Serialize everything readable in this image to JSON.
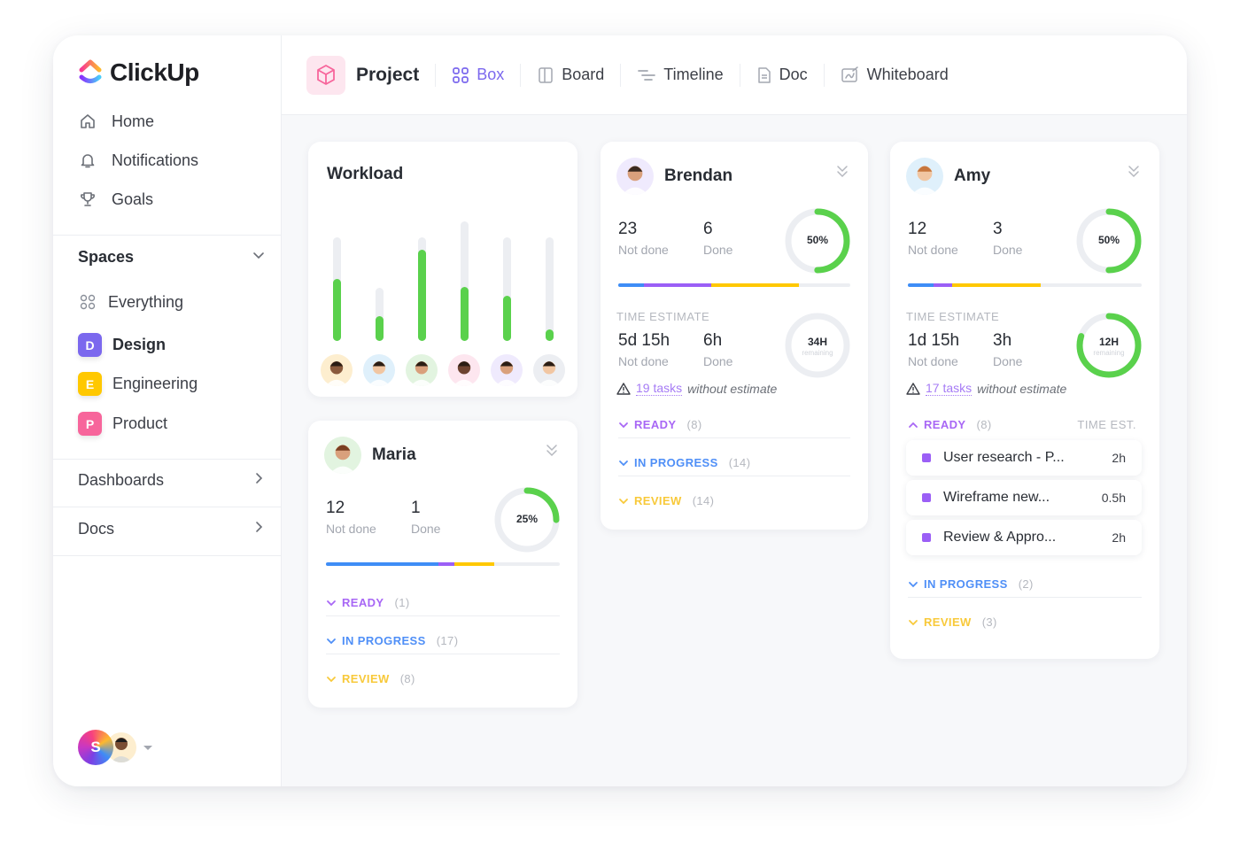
{
  "app": {
    "brand": "ClickUp"
  },
  "sidebar": {
    "nav": [
      {
        "label": "Home",
        "icon": "home-icon"
      },
      {
        "label": "Notifications",
        "icon": "bell-icon"
      },
      {
        "label": "Goals",
        "icon": "trophy-icon"
      }
    ],
    "spaces_label": "Spaces",
    "everything_label": "Everything",
    "spaces": [
      {
        "letter": "D",
        "label": "Design",
        "color": "#7b68ee",
        "active": true
      },
      {
        "letter": "E",
        "label": "Engineering",
        "color": "#ffc800",
        "active": false
      },
      {
        "letter": "P",
        "label": "Product",
        "color": "#f7659b",
        "active": false
      }
    ],
    "dashboards_label": "Dashboards",
    "docs_label": "Docs",
    "user_initial": "S"
  },
  "topbar": {
    "title": "Project",
    "tabs": [
      {
        "label": "Box",
        "icon": "grid-icon",
        "active": true
      },
      {
        "label": "Board",
        "icon": "board-icon",
        "active": false
      },
      {
        "label": "Timeline",
        "icon": "timeline-icon",
        "active": false
      },
      {
        "label": "Doc",
        "icon": "doc-icon",
        "active": false
      },
      {
        "label": "Whiteboard",
        "icon": "whiteboard-icon",
        "active": false
      }
    ]
  },
  "colors": {
    "accent": "#7b68ee",
    "green": "#5ad14c",
    "blue": "#3e8df6",
    "purple": "#9b5ff6",
    "yellow": "#ffc800",
    "ready": "#a867f5",
    "in_progress": "#4f8ff7",
    "review": "#f8c93a"
  },
  "workload": {
    "title": "Workload",
    "bars": [
      {
        "capacity": 0.78,
        "fill": 0.47,
        "avatar_bg": "#fdeecf",
        "skin": "#8a5a3c"
      },
      {
        "capacity": 0.4,
        "fill": 0.19,
        "avatar_bg": "#dff0fb",
        "skin": "#f1c6a2"
      },
      {
        "capacity": 0.78,
        "fill": 0.69,
        "avatar_bg": "#e2f4e0",
        "skin": "#d9a07c"
      },
      {
        "capacity": 0.9,
        "fill": 0.41,
        "avatar_bg": "#fde6ef",
        "skin": "#6d4330"
      },
      {
        "capacity": 0.78,
        "fill": 0.34,
        "avatar_bg": "#efeafd",
        "skin": "#d9a07c"
      },
      {
        "capacity": 0.78,
        "fill": 0.09,
        "avatar_bg": "#eceef2",
        "skin": "#f1c6a2"
      }
    ]
  },
  "people": [
    {
      "id": "maria",
      "name": "Maria",
      "not_done": "12",
      "not_done_label": "Not done",
      "done": "1",
      "done_label": "Done",
      "percent": 25,
      "percent_label": "25%",
      "bar": [
        {
          "color": "#3e8df6",
          "value": 0.48
        },
        {
          "color": "#9b5ff6",
          "value": 0.07
        },
        {
          "color": "#ffc800",
          "value": 0.17
        }
      ],
      "statuses": [
        {
          "label": "READY",
          "count": "(1)",
          "color": "#a867f5",
          "expanded": false
        },
        {
          "label": "IN PROGRESS",
          "count": "(17)",
          "color": "#4f8ff7",
          "expanded": false
        },
        {
          "label": "REVIEW",
          "count": "(8)",
          "color": "#f8c93a",
          "expanded": false
        }
      ]
    },
    {
      "id": "brendan",
      "name": "Brendan",
      "not_done": "23",
      "not_done_label": "Not done",
      "done": "6",
      "done_label": "Done",
      "percent": 50,
      "percent_label": "50%",
      "bar": [
        {
          "color": "#3e8df6",
          "value": 0.11
        },
        {
          "color": "#9b5ff6",
          "value": 0.29
        },
        {
          "color": "#ffc800",
          "value": 0.38
        }
      ],
      "time_estimate": {
        "label": "TIME ESTIMATE",
        "not_done": "5d 15h",
        "not_done_label": "Not done",
        "done": "6h",
        "done_label": "Done",
        "ring_value": "34H",
        "ring_sub": "remaining",
        "ring_fraction": 0,
        "warning_link": "19 tasks",
        "warning_text": "without estimate"
      },
      "statuses": [
        {
          "label": "READY",
          "count": "(8)",
          "color": "#a867f5",
          "expanded": false
        },
        {
          "label": "IN PROGRESS",
          "count": "(14)",
          "color": "#4f8ff7",
          "expanded": false
        },
        {
          "label": "REVIEW",
          "count": "(14)",
          "color": "#f8c93a",
          "expanded": false
        }
      ]
    },
    {
      "id": "amy",
      "name": "Amy",
      "not_done": "12",
      "not_done_label": "Not done",
      "done": "3",
      "done_label": "Done",
      "percent": 50,
      "percent_label": "50%",
      "bar": [
        {
          "color": "#3e8df6",
          "value": 0.11
        },
        {
          "color": "#9b5ff6",
          "value": 0.08
        },
        {
          "color": "#ffc800",
          "value": 0.38
        }
      ],
      "time_estimate": {
        "label": "TIME ESTIMATE",
        "not_done": "1d 15h",
        "not_done_label": "Not done",
        "done": "3h",
        "done_label": "Done",
        "ring_value": "12H",
        "ring_sub": "remaining",
        "ring_fraction": 0.8,
        "warning_link": "17 tasks",
        "warning_text": "without estimate"
      },
      "ready_header": {
        "label": "READY",
        "count": "(8)",
        "time_col": "TIME EST."
      },
      "tasks": [
        {
          "name": "User research - P...",
          "estimate": "2h"
        },
        {
          "name": "Wireframe new...",
          "estimate": "0.5h"
        },
        {
          "name": "Review & Appro...",
          "estimate": "2h"
        }
      ],
      "statuses": [
        {
          "label": "IN PROGRESS",
          "count": "(2)",
          "color": "#4f8ff7",
          "expanded": false
        },
        {
          "label": "REVIEW",
          "count": "(3)",
          "color": "#f8c93a",
          "expanded": false
        }
      ]
    }
  ]
}
